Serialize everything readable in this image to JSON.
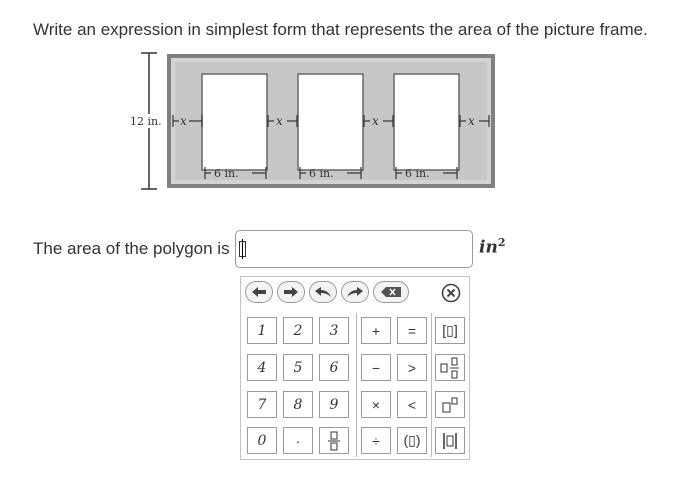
{
  "question": "Write an expression in simplest form that represents the area of the picture frame.",
  "figure": {
    "height_label": "12 in.",
    "x_label": "x",
    "width_label": "6 in."
  },
  "prompt": "The area of the polygon is",
  "answer": {
    "value": ""
  },
  "unit": {
    "base": "in",
    "exponent": "2"
  },
  "keypad": {
    "nav": [
      "left-arrow",
      "right-arrow",
      "undo",
      "redo",
      "backspace"
    ],
    "close": "close-icon",
    "digits": [
      "1",
      "2",
      "3",
      "4",
      "5",
      "6",
      "7",
      "8",
      "9",
      "0",
      "·"
    ],
    "operators": [
      "+",
      "=",
      "−",
      ">",
      "×",
      "<",
      "÷"
    ],
    "templates": [
      "[▯]",
      "mixed-fraction",
      "superscript",
      "(▯)",
      "absolute-value",
      "fraction"
    ]
  }
}
